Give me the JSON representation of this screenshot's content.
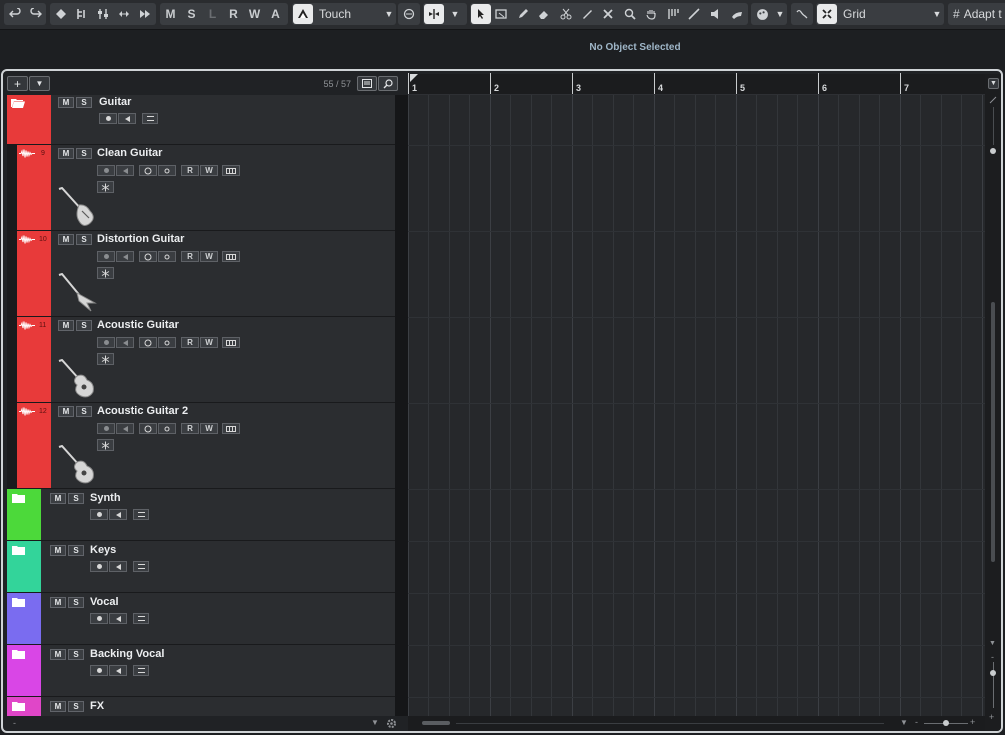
{
  "toolbar": {
    "automation_mode": "Touch",
    "snap_type": "Grid",
    "adapt_label": "Adapt t",
    "mode_letters": [
      "M",
      "S",
      "L",
      "R",
      "W",
      "A"
    ]
  },
  "info_line": {
    "text": "No Object Selected"
  },
  "tracklist": {
    "count": "55 / 57",
    "add_label": "+",
    "tracks": [
      {
        "name": "Guitar",
        "type": "folder",
        "color": "#e83a3a"
      },
      {
        "name": "Clean Guitar",
        "type": "audio",
        "number": "9",
        "color": "#e83a3a"
      },
      {
        "name": "Distortion Guitar",
        "type": "audio",
        "number": "10",
        "color": "#e83a3a"
      },
      {
        "name": "Acoustic Guitar",
        "type": "audio",
        "number": "11",
        "color": "#e83a3a"
      },
      {
        "name": "Acoustic Guitar 2",
        "type": "audio",
        "number": "12",
        "color": "#e83a3a"
      },
      {
        "name": "Synth",
        "type": "folder",
        "color": "#4cd93a"
      },
      {
        "name": "Keys",
        "type": "folder",
        "color": "#33d49a"
      },
      {
        "name": "Vocal",
        "type": "folder",
        "color": "#7a6cf0"
      },
      {
        "name": "Backing Vocal",
        "type": "folder",
        "color": "#d946e6"
      },
      {
        "name": "FX",
        "type": "folder",
        "color": "#e046c8"
      }
    ],
    "button_labels": {
      "mute": "M",
      "solo": "S",
      "read": "R",
      "write": "W"
    }
  },
  "ruler": {
    "bars": [
      "1",
      "2",
      "3",
      "4",
      "5",
      "6",
      "7"
    ]
  }
}
